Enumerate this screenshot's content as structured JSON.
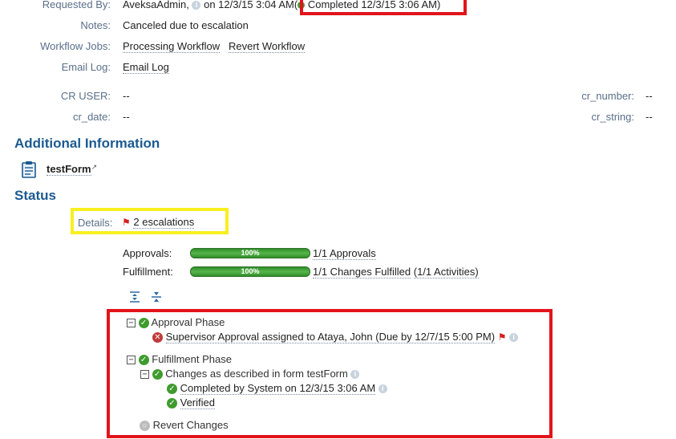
{
  "request": {
    "requested_by_label": "Requested By:",
    "requested_by_user": "AveksaAdmin,",
    "requested_on": "on 12/3/15 3:04 AM",
    "status_open": "(",
    "status_text": "Completed 12/3/15 3:06 AM)",
    "notes_label": "Notes:",
    "notes_value": "Canceled due to escalation",
    "workflow_jobs_label": "Workflow Jobs:",
    "workflow_job_1": "Processing Workflow",
    "workflow_job_2": "Revert Workflow",
    "email_log_label": "Email Log:",
    "email_log_link": "Email Log"
  },
  "custom_fields": {
    "cr_user_label": "CR USER:",
    "cr_user_value": "--",
    "cr_date_label": "cr_date:",
    "cr_date_value": "--",
    "cr_number_label": "cr_number:",
    "cr_number_value": "--",
    "cr_string_label": "cr_string:",
    "cr_string_value": "--"
  },
  "additional_info": {
    "heading": "Additional Information",
    "form_link": "testForm"
  },
  "status": {
    "heading": "Status",
    "details_label": "Details:",
    "escalations": "2 escalations",
    "approvals_label": "Approvals:",
    "approvals_percent": "100%",
    "approvals_progress": 1.0,
    "approvals_summary": "1/1 Approvals",
    "fulfillment_label": "Fulfillment:",
    "fulfillment_percent": "100%",
    "fulfillment_progress": 1.0,
    "fulfillment_summary": "1/1 Changes Fulfilled",
    "fulfillment_activities": "(1/1 Activities)"
  },
  "tree": {
    "approval_phase": "Approval Phase",
    "supervisor_approval": "Supervisor Approval assigned to Ataya, John (Due by 12/7/15 5:00 PM)",
    "fulfillment_phase": "Fulfillment Phase",
    "changes_form": "Changes as described in form testForm",
    "completed_by": "Completed by System on 12/3/15 3:06 AM",
    "verified": "Verified",
    "revert_changes": "Revert Changes"
  },
  "colors": {
    "highlight_red": "#e2141b",
    "highlight_yellow": "#f7ef1f",
    "heading_blue": "#1c5a91",
    "progress_green": "#3f9b2e"
  }
}
